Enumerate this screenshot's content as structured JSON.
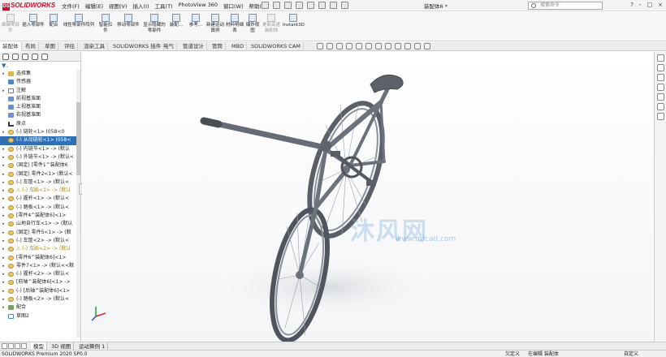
{
  "app": {
    "logo": "SOLIDWORKS",
    "document_title": "装配体6 *",
    "search_placeholder": "搜索命令",
    "window_controls": [
      "?",
      "-",
      "□",
      "×"
    ]
  },
  "menu": [
    "文件(F)",
    "编辑(E)",
    "视图(V)",
    "插入(I)",
    "工具(T)",
    "PhotoView 360",
    "窗口(W)",
    "帮助(H)"
  ],
  "ribbon": [
    {
      "label": "编辑零部件",
      "disabled": true
    },
    {
      "label": "插入零部件",
      "disabled": false
    },
    {
      "label": "配合",
      "disabled": false
    },
    {
      "label": "线性零部件阵列",
      "disabled": false
    },
    {
      "label": "智能扣件",
      "disabled": false
    },
    {
      "label": "移动零部件",
      "disabled": false
    },
    {
      "label": "显示隐藏的零部件",
      "disabled": false
    },
    {
      "label": "装配...",
      "disabled": false
    },
    {
      "label": "参考...",
      "disabled": false
    },
    {
      "label": "新建运动算例",
      "disabled": false
    },
    {
      "label": "材料明细表",
      "disabled": false
    },
    {
      "label": "爆炸视图",
      "disabled": false
    },
    {
      "label": "更新高速装配体",
      "disabled": true
    },
    {
      "label": "Instant3D",
      "disabled": false
    }
  ],
  "command_tabs": [
    "装配体",
    "布局",
    "草图",
    "评估",
    "渲染工具",
    "SOLIDWORKS 插件",
    "电气",
    "管道设计",
    "管筒",
    "MBD",
    "SOLIDWORKS CAM"
  ],
  "feature_tree": [
    {
      "label": "选择集",
      "icon": "folder",
      "expand": "▸"
    },
    {
      "label": "传感器",
      "icon": "sensor",
      "expand": ""
    },
    {
      "label": "注解",
      "icon": "note",
      "expand": "▸"
    },
    {
      "label": "前视基准面",
      "icon": "plane",
      "expand": ""
    },
    {
      "label": "上视基准面",
      "icon": "plane",
      "expand": ""
    },
    {
      "label": "右视基准面",
      "icon": "plane",
      "expand": ""
    },
    {
      "label": "原点",
      "icon": "origin",
      "expand": ""
    },
    {
      "label": "(-) 链轮<1> (058<0",
      "icon": "part",
      "expand": "▸"
    },
    {
      "label": "(-) 从动链轮<1> (058<",
      "icon": "part",
      "expand": "▸",
      "selected": true
    },
    {
      "label": "(-) 内链节<1> -> (默认",
      "icon": "part",
      "expand": "▸"
    },
    {
      "label": "(-) 外链节<1> -> (默认<",
      "icon": "part",
      "expand": "▸"
    },
    {
      "label": "(固定) [零件1^装配体6",
      "icon": "part",
      "expand": "▸"
    },
    {
      "label": "(固定) 零件2<1> (默认<",
      "icon": "part",
      "expand": "▸"
    },
    {
      "label": "(-) 车筐<1> -> (默认<",
      "icon": "part",
      "expand": "▸"
    },
    {
      "label": "⚠ (-) 车胎<1> -> (默认",
      "icon": "part",
      "expand": "▸",
      "warn": true
    },
    {
      "label": "(-) 握杆<1> -> (默认<",
      "icon": "part",
      "expand": "▸"
    },
    {
      "label": "(-) 踏板<1> -> (默认<",
      "icon": "part",
      "expand": "▸"
    },
    {
      "label": "[零件4^装配体6]<1>",
      "icon": "part",
      "expand": "▸"
    },
    {
      "label": "山地自行车<1> -> (默认",
      "icon": "part",
      "expand": "▸"
    },
    {
      "label": "(固定) 零件5<1> -> (默",
      "icon": "part",
      "expand": "▸"
    },
    {
      "label": "(-) 车筐<2> -> (默认<",
      "icon": "part",
      "expand": "▸"
    },
    {
      "label": "⚠ (-) 车胎<2> -> (默认",
      "icon": "part",
      "expand": "▸",
      "warn": true
    },
    {
      "label": "[零件6^装配体6]<1>",
      "icon": "part",
      "expand": "▸"
    },
    {
      "label": "零件7<1> -> (默认<<默",
      "icon": "part",
      "expand": "▸"
    },
    {
      "label": "(-) 握杆<2> -> (默认<",
      "icon": "part",
      "expand": "▸"
    },
    {
      "label": "[前轴^装配体6]<1> ->",
      "icon": "part",
      "expand": "▸"
    },
    {
      "label": "(-) [后轴^装配体6]<1>",
      "icon": "part",
      "expand": "▸"
    },
    {
      "label": "(-) 踏板<2> -> (默认<",
      "icon": "part",
      "expand": "▸"
    },
    {
      "label": "配合",
      "icon": "mates",
      "expand": "▸"
    },
    {
      "label": "草图2",
      "icon": "sketch",
      "expand": ""
    }
  ],
  "bottom_tabs": [
    "模型",
    "3D 视图",
    "运动算例 1"
  ],
  "status": {
    "left": "SOLIDWORKS Premium 2020 SP0.0",
    "undefined": "欠定义",
    "editing": "在编辑 装配体",
    "custom": "自定义"
  },
  "watermark": {
    "text": "沐风网",
    "url": "www.mfcad.com"
  }
}
